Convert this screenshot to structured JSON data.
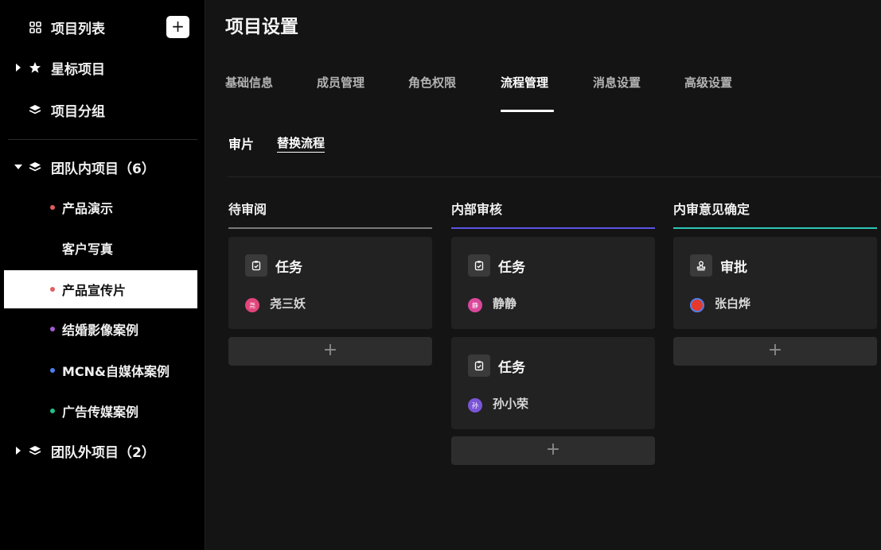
{
  "sidebar": {
    "project_list": "项目列表",
    "add_label": "+",
    "starred": "星标项目",
    "groups": "项目分组",
    "team_internal": "团队内项目（6）",
    "projects": [
      {
        "label": "产品演示",
        "dot": "#e25d5d"
      },
      {
        "label": "客户写真",
        "dot": ""
      },
      {
        "label": "产品宣传片",
        "dot": "#e25d5d"
      },
      {
        "label": "结婚影像案例",
        "dot": "#a55bd6"
      },
      {
        "label": "MCN&自媒体案例",
        "dot": "#4b7ff0"
      },
      {
        "label": "广告传媒案例",
        "dot": "#22c08a"
      }
    ],
    "active_index": 2,
    "team_external": "团队外项目（2）"
  },
  "main": {
    "title": "项目设置",
    "tabs": [
      "基础信息",
      "成员管理",
      "角色权限",
      "流程管理",
      "消息设置",
      "高级设置"
    ],
    "active_tab": 3,
    "subtabs": {
      "review": "审片",
      "replace": "替换流程"
    },
    "columns": [
      {
        "title": "待审阅",
        "line_color": "#7a7a7a",
        "cards": [
          {
            "type": "任务",
            "icon": "clipboard-icon",
            "assignee": "尧三妖",
            "avatar_text": "尧",
            "avatar_color": "#e0457b"
          }
        ],
        "add": "+"
      },
      {
        "title": "内部审核",
        "line_color": "#5b55e6",
        "cards": [
          {
            "type": "任务",
            "icon": "clipboard-icon",
            "assignee": "静静",
            "avatar_text": "静",
            "avatar_color": "#d9489a"
          },
          {
            "type": "任务",
            "icon": "clipboard-icon",
            "assignee": "孙小荣",
            "avatar_text": "孙",
            "avatar_color": "#7a55d6"
          }
        ],
        "add": "+"
      },
      {
        "title": "内审意见确定",
        "line_color": "#2ec7b6",
        "cards": [
          {
            "type": "审批",
            "icon": "stamp-icon",
            "assignee": "张白烨",
            "avatar_text": "",
            "avatar_color": "#e53a2b"
          }
        ],
        "add": "+"
      }
    ]
  }
}
